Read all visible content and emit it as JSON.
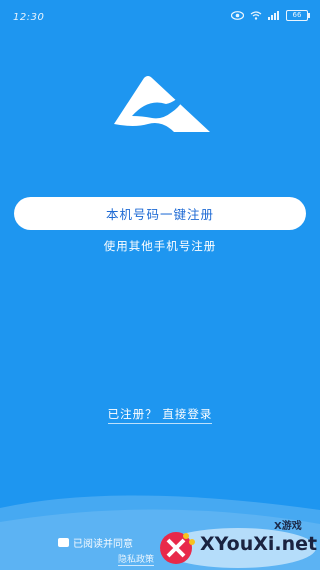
{
  "status_bar": {
    "time": "12:30",
    "battery": "66"
  },
  "colors": {
    "background": "#1e96f0",
    "button_text": "#1e6ad4",
    "accent_white": "#ffffff"
  },
  "actions": {
    "one_click_register": "本机号码一键注册",
    "other_phone_register": "使用其他手机号注册",
    "login": "已注册？ 直接登录"
  },
  "agreement": {
    "text": "已阅读并同意",
    "policy_link": "隐私政策"
  },
  "watermark": {
    "brand": "XYouXi.net",
    "tag": "X游戏"
  },
  "icons": [
    "eye-icon",
    "wifi-icon",
    "signal-icon",
    "battery-icon",
    "app-logo",
    "checkbox"
  ]
}
